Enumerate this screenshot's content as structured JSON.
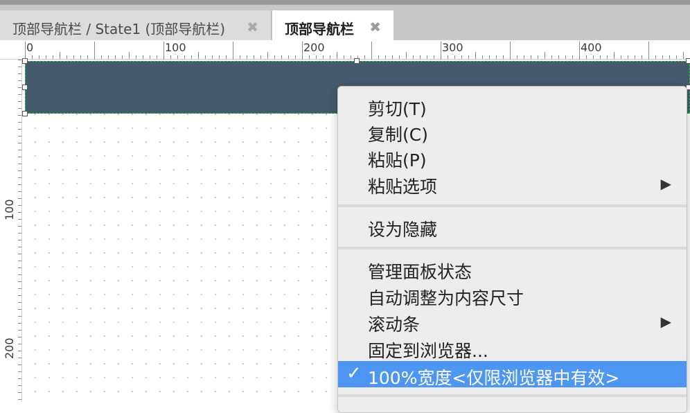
{
  "tabs": [
    {
      "label": "顶部导航栏 / State1 (顶部导航栏)",
      "close": "✖",
      "active": false
    },
    {
      "label": "顶部导航栏",
      "close": "✖",
      "active": true
    }
  ],
  "ruler": {
    "horizontal_labels": [
      "0",
      "100",
      "200",
      "300",
      "400"
    ],
    "vertical_labels": [
      "100",
      "200"
    ]
  },
  "canvas": {
    "widget_name": "顶部导航栏",
    "widget_color": "#455a6a",
    "selection_color": "#2fd34a"
  },
  "context_menu": {
    "items": [
      {
        "label": "剪切(T)"
      },
      {
        "label": "复制(C)"
      },
      {
        "label": "粘贴(P)"
      },
      {
        "label": "粘贴选项",
        "submenu_arrow": "▶"
      },
      {
        "label": "设为隐藏"
      },
      {
        "label": "管理面板状态"
      },
      {
        "label": "自动调整为内容尺寸"
      },
      {
        "label": "滚动条",
        "submenu_arrow": "▶"
      },
      {
        "label": "固定到浏览器..."
      },
      {
        "label": "100%宽度<仅限浏览器中有效>",
        "checked": true,
        "check": "✓"
      }
    ],
    "highlight_color": "#4d96f2"
  }
}
